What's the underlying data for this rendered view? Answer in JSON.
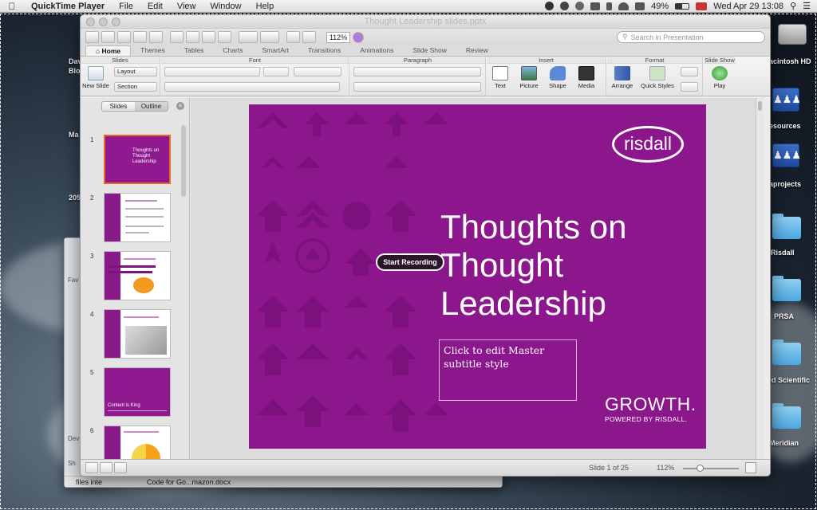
{
  "menubar": {
    "apple": "",
    "app_name": "QuickTime Player",
    "items": [
      "File",
      "Edit",
      "View",
      "Window",
      "Help"
    ],
    "battery": "49%",
    "datetime": "Wed Apr 29  13:08"
  },
  "desktop": {
    "left_labels": [
      "Dav",
      "Blo",
      "Ma",
      "205"
    ],
    "right_items": [
      "acintosh HD",
      "esources",
      "aprojects",
      "Risdall",
      "PRSA",
      "ed Scientific",
      "Meridian"
    ]
  },
  "finder": {
    "bottom_items": [
      "files inte",
      "Code for Go...mazon.docx"
    ],
    "side_labels": [
      "Fav",
      "Dev",
      "Sh"
    ]
  },
  "window": {
    "title": "Thought Leadership slides.pptx",
    "zoom": "112%",
    "search_placeholder": "Search in Presentation"
  },
  "tabs": [
    "Home",
    "Themes",
    "Tables",
    "Charts",
    "SmartArt",
    "Transitions",
    "Animations",
    "Slide Show",
    "Review"
  ],
  "ribbon": {
    "groups": {
      "slides": "Slides",
      "font": "Font",
      "paragraph": "Paragraph",
      "insert": "Insert",
      "format": "Format",
      "slideshow": "Slide Show"
    },
    "new_slide": "New Slide",
    "layout": "Layout",
    "section": "Section",
    "text": "Text",
    "picture": "Picture",
    "shape": "Shape",
    "media": "Media",
    "arrange": "Arrange",
    "quick_styles": "Quick Styles",
    "play": "Play"
  },
  "left_pane": {
    "tab_slides": "Slides",
    "tab_outline": "Outline",
    "thumbs": [
      {
        "num": "1",
        "title": "Thoughts on Thought Leadership"
      },
      {
        "num": "2"
      },
      {
        "num": "3"
      },
      {
        "num": "4"
      },
      {
        "num": "5",
        "title": "Content is King"
      },
      {
        "num": "6"
      }
    ]
  },
  "slide": {
    "logo": "risdall",
    "title_lines": [
      "Thoughts on",
      "Thought",
      "Leadership"
    ],
    "subtitle": "Click to edit Master subtitle style",
    "growth": "GROWTH.",
    "powered": "POWERED BY RISDALL."
  },
  "overlay": {
    "record_button": "Start Recording"
  },
  "status": {
    "slide_count": "Slide 1 of 25",
    "zoom": "112%"
  }
}
